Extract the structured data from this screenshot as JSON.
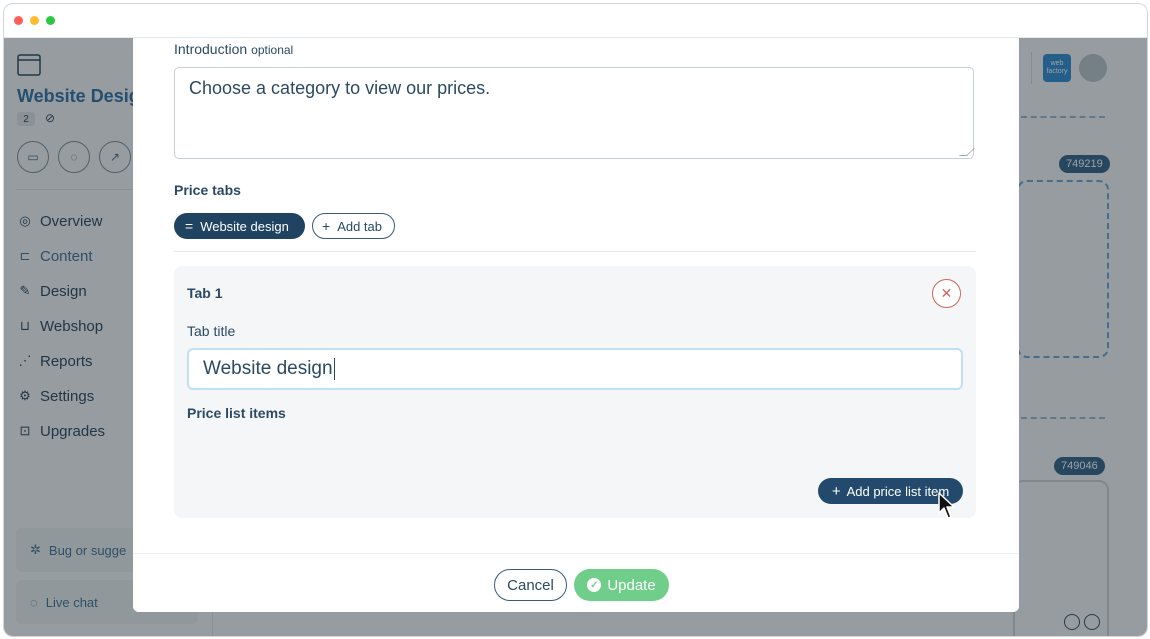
{
  "colors": {
    "accent_dark": "#1f4361",
    "success": "#6fcf8a",
    "danger": "#d2645e",
    "link_blue": "#3d6d90"
  },
  "sidebar": {
    "site_title": "Website Desig",
    "page_count": "2",
    "icon_buttons": [
      "folder-icon",
      "chat-icon",
      "external-link-icon"
    ],
    "items": [
      {
        "label": "Overview",
        "icon": "compass-icon"
      },
      {
        "label": "Content",
        "icon": "content-tree-icon"
      },
      {
        "label": "Design",
        "icon": "brush-icon"
      },
      {
        "label": "Webshop",
        "icon": "basket-icon"
      },
      {
        "label": "Reports",
        "icon": "chart-icon"
      },
      {
        "label": "Settings",
        "icon": "gear-icon"
      },
      {
        "label": "Upgrades",
        "icon": "upgrade-icon"
      }
    ],
    "bug_report": "Bug or sugge",
    "live_chat": "Live chat"
  },
  "header": {
    "brand_logo_text": "web factory"
  },
  "canvas": {
    "block_ids": [
      "749219",
      "749046"
    ]
  },
  "modal": {
    "intro_label": "Introduction",
    "intro_optional": "optional",
    "intro_value": "Choose a category to view our prices.",
    "price_tabs_heading": "Price tabs",
    "tabs": [
      {
        "label": "Website design"
      }
    ],
    "add_tab_label": "Add tab",
    "tab_card": {
      "heading": "Tab 1",
      "title_label": "Tab title",
      "title_value": "Website design",
      "items_heading": "Price list items",
      "add_item_label": "Add price list item"
    },
    "cancel_label": "Cancel",
    "update_label": "Update"
  }
}
